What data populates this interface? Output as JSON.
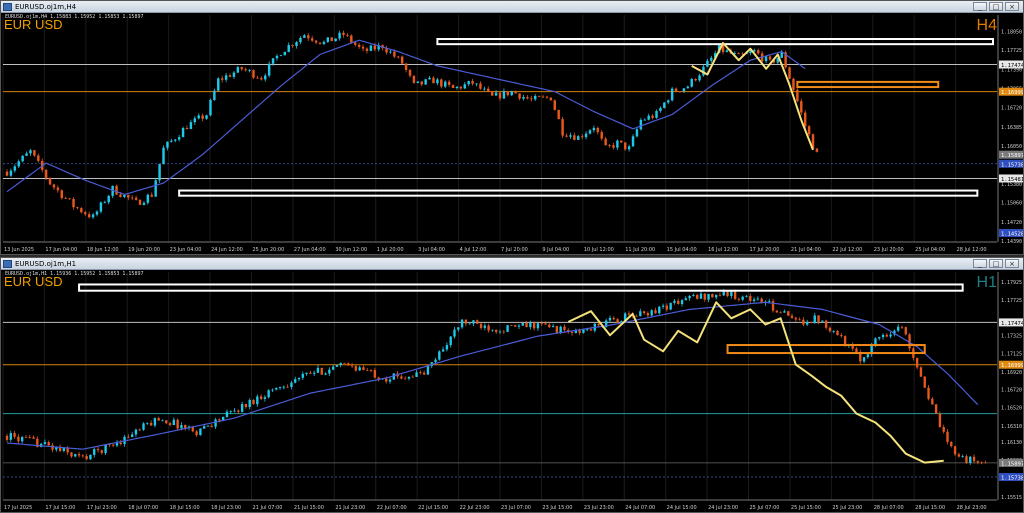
{
  "colors": {
    "bull": "#1ec8e8",
    "bear": "#e8581c",
    "ma": "#4a5cd6",
    "box_white": "#ffffff",
    "box_orange": "#f08a18",
    "zigzag": "#f5e27a",
    "hline_white": "#bfbfbf",
    "hline_orange": "#d8820a",
    "hline_teal": "#1f9d9d",
    "grid": "#1c1c1c",
    "axis_text": "#cfcfcf"
  },
  "windows": [
    {
      "id": "h4",
      "title": "EURUSD.oj1m,H4",
      "ohlc": "EURUSD.oj1m,H4  1.15883 1.15952 1.15853 1.15897",
      "symbol_label": "EUR USD",
      "timeframe_label": "H4",
      "icons": [
        "window-icon",
        "minimize-icon",
        "maximize-icon",
        "close-icon"
      ]
    },
    {
      "id": "h1",
      "title": "EURUSD.oj1m,H1",
      "ohlc": "EURUSD.oj1m,H1  1.15936 1.15952 1.15853 1.15897",
      "symbol_label": "EUR USD",
      "timeframe_label": "H1",
      "icons": [
        "window-icon",
        "minimize-icon",
        "maximize-icon",
        "close-icon"
      ]
    }
  ],
  "chart_data": [
    {
      "type": "candlestick",
      "symbol": "EURUSD",
      "timeframe": "H4",
      "ylim": [
        1.1437,
        1.1834
      ],
      "y_ticks": [
        {
          "label": "1.18050",
          "value": 1.1805
        },
        {
          "label": "1.17725",
          "value": 1.17725
        },
        {
          "label": "1.17474",
          "value": 1.17474,
          "highlight": "white"
        },
        {
          "label": "1.17390",
          "value": 1.1739
        },
        {
          "label": "1.17055",
          "value": 1.17055
        },
        {
          "label": "1.16999",
          "value": 1.16999,
          "highlight": "orange"
        },
        {
          "label": "1.16720",
          "value": 1.1672
        },
        {
          "label": "1.16385",
          "value": 1.16385
        },
        {
          "label": "1.16050",
          "value": 1.1605
        },
        {
          "label": "1.15897",
          "value": 1.15897,
          "highlight": "grey"
        },
        {
          "label": "1.15738",
          "value": 1.15738,
          "highlight": "blue"
        },
        {
          "label": "1.15481",
          "value": 1.15481,
          "highlight": "white"
        },
        {
          "label": "1.15380",
          "value": 1.1538
        },
        {
          "label": "1.15060",
          "value": 1.1506
        },
        {
          "label": "1.14720",
          "value": 1.1472
        },
        {
          "label": "1.14528",
          "value": 1.14528,
          "highlight": "blue"
        },
        {
          "label": "1.14390",
          "value": 1.1439
        }
      ],
      "x_labels": [
        "13 Jun 2025",
        "17 Jun 04:00",
        "18 Jun 12:00",
        "19 Jun 20:00",
        "23 Jun 04:00",
        "24 Jun 12:00",
        "25 Jun 20:00",
        "27 Jun 04:00",
        "30 Jun 12:00",
        "1 Jul 20:00",
        "3 Jul 04:00",
        "4 Jul 12:00",
        "7 Jul 20:00",
        "9 Jul 04:00",
        "10 Jul 12:00",
        "11 Jul 20:00",
        "15 Jul 04:00",
        "16 Jul 12:00",
        "17 Jul 20:00",
        "21 Jul 04:00",
        "22 Jul 12:00",
        "23 Jul 20:00",
        "25 Jul 04:00",
        "28 Jul 12:00"
      ],
      "hlines": [
        {
          "value": 1.17474,
          "color": "white"
        },
        {
          "value": 1.16999,
          "color": "orange"
        },
        {
          "value": 1.15481,
          "color": "white"
        },
        {
          "value": 1.15738,
          "color": "blue",
          "dotted": true
        }
      ],
      "boxes": [
        {
          "color": "white",
          "from_bar": 110,
          "to_bar": 252,
          "top": 1.1792,
          "bottom": 1.1783
        },
        {
          "color": "white",
          "from_bar": 44,
          "to_bar": 248,
          "top": 1.1527,
          "bottom": 1.1518
        },
        {
          "color": "orange",
          "from_bar": 202,
          "to_bar": 238,
          "top": 1.1717,
          "bottom": 1.1708
        }
      ],
      "zigzag": [
        [
          175,
          1.1745
        ],
        [
          179,
          1.173
        ],
        [
          183,
          1.1785
        ],
        [
          187,
          1.1755
        ],
        [
          190,
          1.1775
        ],
        [
          194,
          1.174
        ],
        [
          197,
          1.1765
        ],
        [
          200,
          1.1712
        ],
        [
          203,
          1.165
        ],
        [
          206,
          1.1598
        ]
      ],
      "price_path": [
        [
          0,
          1.156
        ],
        [
          6,
          1.1595
        ],
        [
          11,
          1.154
        ],
        [
          17,
          1.15
        ],
        [
          22,
          1.148
        ],
        [
          27,
          1.153
        ],
        [
          33,
          1.1505
        ],
        [
          37,
          1.152
        ],
        [
          40,
          1.16
        ],
        [
          46,
          1.164
        ],
        [
          51,
          1.166
        ],
        [
          54,
          1.172
        ],
        [
          60,
          1.174
        ],
        [
          65,
          1.1725
        ],
        [
          70,
          1.177
        ],
        [
          76,
          1.18
        ],
        [
          81,
          1.1785
        ],
        [
          86,
          1.18
        ],
        [
          91,
          1.177
        ],
        [
          96,
          1.178
        ],
        [
          101,
          1.175
        ],
        [
          104,
          1.171
        ],
        [
          109,
          1.172
        ],
        [
          114,
          1.1705
        ],
        [
          119,
          1.1715
        ],
        [
          124,
          1.169
        ],
        [
          129,
          1.17
        ],
        [
          134,
          1.1685
        ],
        [
          139,
          1.169
        ],
        [
          142,
          1.163
        ],
        [
          146,
          1.162
        ],
        [
          150,
          1.164
        ],
        [
          153,
          1.16
        ],
        [
          156,
          1.161
        ],
        [
          159,
          1.16
        ],
        [
          162,
          1.165
        ],
        [
          166,
          1.166
        ],
        [
          170,
          1.17
        ],
        [
          174,
          1.171
        ],
        [
          178,
          1.174
        ],
        [
          182,
          1.1775
        ],
        [
          187,
          1.176
        ],
        [
          191,
          1.177
        ],
        [
          195,
          1.175
        ],
        [
          198,
          1.1765
        ],
        [
          201,
          1.1705
        ],
        [
          204,
          1.164
        ],
        [
          207,
          1.159
        ]
      ],
      "ma_path": [
        [
          0,
          1.1525
        ],
        [
          10,
          1.1575
        ],
        [
          20,
          1.1545
        ],
        [
          30,
          1.152
        ],
        [
          40,
          1.154
        ],
        [
          50,
          1.159
        ],
        [
          60,
          1.165
        ],
        [
          70,
          1.171
        ],
        [
          80,
          1.1765
        ],
        [
          90,
          1.179
        ],
        [
          100,
          1.177
        ],
        [
          110,
          1.1745
        ],
        [
          120,
          1.173
        ],
        [
          130,
          1.1715
        ],
        [
          140,
          1.17
        ],
        [
          150,
          1.1665
        ],
        [
          160,
          1.1635
        ],
        [
          170,
          1.166
        ],
        [
          180,
          1.171
        ],
        [
          190,
          1.1755
        ],
        [
          198,
          1.177
        ],
        [
          204,
          1.174
        ]
      ],
      "bars_total": 252,
      "seed": 7
    },
    {
      "type": "candlestick",
      "symbol": "EURUSD",
      "timeframe": "H1",
      "ylim": [
        1.1548,
        1.1804
      ],
      "y_ticks": [
        {
          "label": "1.17925",
          "value": 1.17925
        },
        {
          "label": "1.17725",
          "value": 1.17725
        },
        {
          "label": "1.17474",
          "value": 1.17474,
          "highlight": "white"
        },
        {
          "label": "1.17325",
          "value": 1.17325
        },
        {
          "label": "1.17125",
          "value": 1.17125
        },
        {
          "label": "1.16999",
          "value": 1.16999,
          "highlight": "orange"
        },
        {
          "label": "1.16920",
          "value": 1.1692
        },
        {
          "label": "1.16720",
          "value": 1.1672
        },
        {
          "label": "1.16520",
          "value": 1.1652
        },
        {
          "label": "1.16310",
          "value": 1.1631
        },
        {
          "label": "1.16130",
          "value": 1.1613
        },
        {
          "label": "1.15930",
          "value": 1.1593
        },
        {
          "label": "1.15897",
          "value": 1.15897,
          "highlight": "grey"
        },
        {
          "label": "1.15730",
          "value": 1.1573
        },
        {
          "label": "1.15738",
          "value": 1.15738,
          "highlight": "blue"
        },
        {
          "label": "1.15515",
          "value": 1.15515
        }
      ],
      "x_labels": [
        "17 Jul 2025",
        "17 Jul 15:00",
        "17 Jul 23:00",
        "18 Jul 07:00",
        "18 Jul 15:00",
        "18 Jul 23:00",
        "21 Jul 07:00",
        "21 Jul 15:00",
        "21 Jul 23:00",
        "22 Jul 07:00",
        "22 Jul 15:00",
        "22 Jul 23:00",
        "23 Jul 07:00",
        "23 Jul 15:00",
        "23 Jul 23:00",
        "24 Jul 07:00",
        "24 Jul 15:00",
        "24 Jul 23:00",
        "25 Jul 07:00",
        "25 Jul 15:00",
        "25 Jul 23:00",
        "28 Jul 07:00",
        "28 Jul 15:00",
        "28 Jul 23:00"
      ],
      "hlines": [
        {
          "value": 1.17474,
          "color": "white"
        },
        {
          "value": 1.16999,
          "color": "orange"
        },
        {
          "value": 1.1645,
          "color": "teal"
        },
        {
          "value": 1.15897,
          "color": "grey"
        },
        {
          "value": 1.15738,
          "color": "blue",
          "dotted": true
        }
      ],
      "boxes": [
        {
          "color": "white",
          "from_bar": 19,
          "to_bar": 252,
          "top": 1.179,
          "bottom": 1.1783
        },
        {
          "color": "orange",
          "from_bar": 190,
          "to_bar": 242,
          "top": 1.1722,
          "bottom": 1.1713
        }
      ],
      "zigzag": [
        [
          148,
          1.1748
        ],
        [
          154,
          1.176
        ],
        [
          159,
          1.1733
        ],
        [
          165,
          1.1757
        ],
        [
          168,
          1.1728
        ],
        [
          173,
          1.1715
        ],
        [
          177,
          1.1738
        ],
        [
          182,
          1.1725
        ],
        [
          187,
          1.177
        ],
        [
          191,
          1.1752
        ],
        [
          196,
          1.1762
        ],
        [
          200,
          1.1745
        ],
        [
          204,
          1.1752
        ],
        [
          208,
          1.17
        ],
        [
          212,
          1.1688
        ],
        [
          216,
          1.1675
        ],
        [
          220,
          1.1665
        ],
        [
          224,
          1.1645
        ],
        [
          229,
          1.1635
        ],
        [
          233,
          1.162
        ],
        [
          237,
          1.16
        ],
        [
          242,
          1.159
        ],
        [
          247,
          1.1592
        ]
      ],
      "price_path": [
        [
          0,
          1.162
        ],
        [
          10,
          1.161
        ],
        [
          20,
          1.1595
        ],
        [
          30,
          1.1615
        ],
        [
          40,
          1.164
        ],
        [
          50,
          1.1625
        ],
        [
          60,
          1.1648
        ],
        [
          70,
          1.1672
        ],
        [
          80,
          1.169
        ],
        [
          90,
          1.17
        ],
        [
          100,
          1.1685
        ],
        [
          110,
          1.169
        ],
        [
          120,
          1.1748
        ],
        [
          130,
          1.174
        ],
        [
          140,
          1.1745
        ],
        [
          150,
          1.1735
        ],
        [
          160,
          1.175
        ],
        [
          170,
          1.176
        ],
        [
          180,
          1.1775
        ],
        [
          190,
          1.178
        ],
        [
          200,
          1.177
        ],
        [
          208,
          1.1748
        ],
        [
          214,
          1.1752
        ],
        [
          219,
          1.1735
        ],
        [
          225,
          1.1705
        ],
        [
          230,
          1.1732
        ],
        [
          236,
          1.1742
        ],
        [
          240,
          1.17
        ],
        [
          244,
          1.1652
        ],
        [
          248,
          1.161
        ],
        [
          253,
          1.1593
        ],
        [
          258,
          1.159
        ]
      ],
      "ma_path": [
        [
          0,
          1.1612
        ],
        [
          20,
          1.1605
        ],
        [
          40,
          1.1622
        ],
        [
          60,
          1.164
        ],
        [
          80,
          1.1668
        ],
        [
          100,
          1.1685
        ],
        [
          120,
          1.171
        ],
        [
          140,
          1.1732
        ],
        [
          160,
          1.1745
        ],
        [
          180,
          1.1762
        ],
        [
          200,
          1.177
        ],
        [
          215,
          1.1762
        ],
        [
          230,
          1.1745
        ],
        [
          240,
          1.172
        ],
        [
          248,
          1.169
        ],
        [
          256,
          1.1655
        ]
      ],
      "bars_total": 260,
      "seed": 13
    }
  ]
}
